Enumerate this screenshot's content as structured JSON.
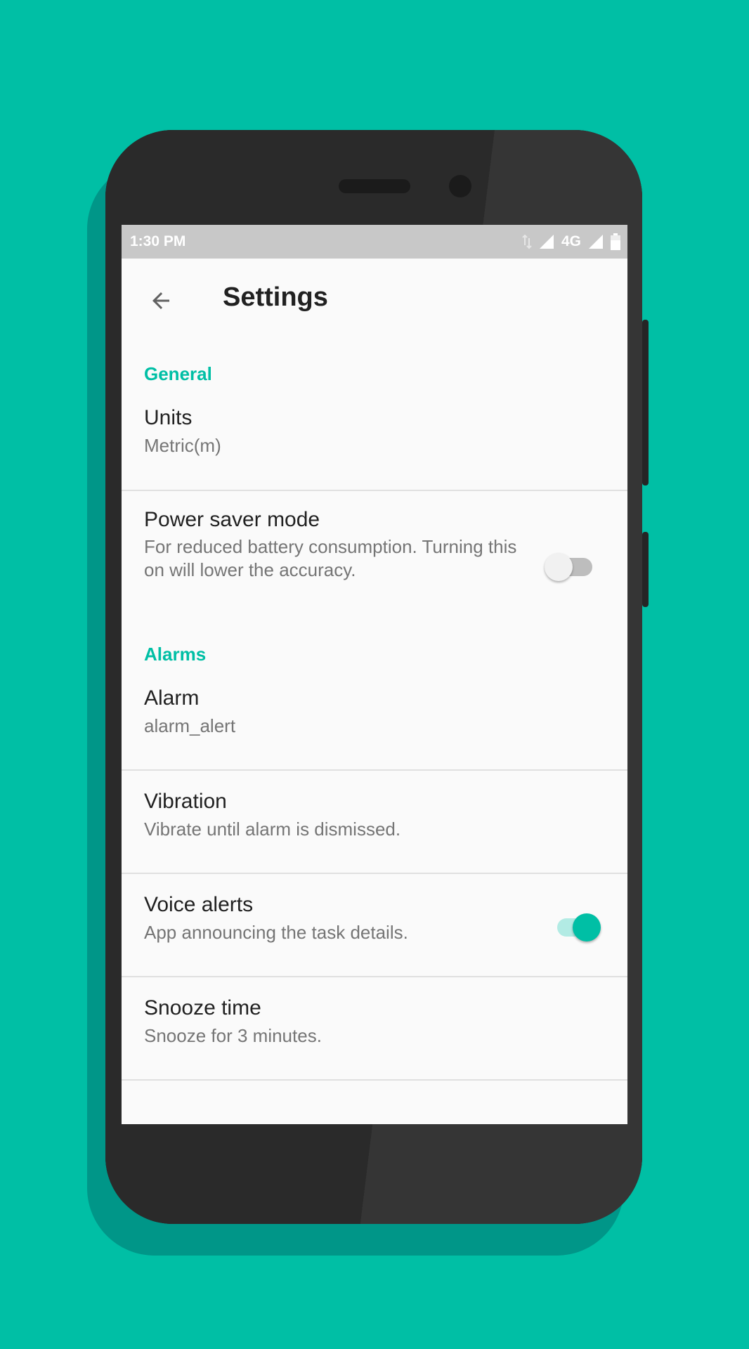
{
  "colors": {
    "accent": "#00BFA5",
    "background": "#00BFA5"
  },
  "status_bar": {
    "time": "1:30 PM",
    "network": "4G"
  },
  "app_bar": {
    "title": "Settings",
    "back_icon": "arrow-back-icon"
  },
  "sections": [
    {
      "header": "General"
    },
    {
      "header": "Alarms"
    }
  ],
  "settings": {
    "units": {
      "title": "Units",
      "summary": "Metric(m)"
    },
    "power_saver": {
      "title": "Power saver mode",
      "summary": "For reduced battery consumption. Turning this on will lower the accuracy.",
      "enabled": false
    },
    "alarm": {
      "title": "Alarm",
      "summary": "alarm_alert"
    },
    "vibration": {
      "title": "Vibration",
      "summary": "Vibrate until alarm is dismissed."
    },
    "voice_alerts": {
      "title": "Voice alerts",
      "summary": "App announcing the task details.",
      "enabled": true
    },
    "snooze": {
      "title": "Snooze time",
      "summary": "Snooze for 3 minutes."
    }
  }
}
